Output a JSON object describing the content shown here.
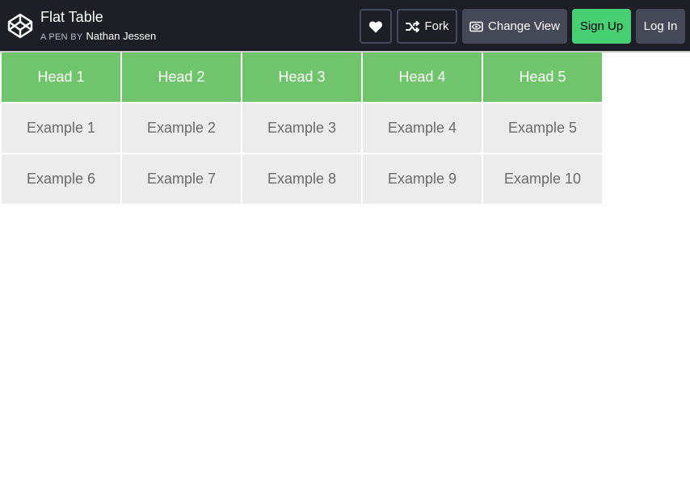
{
  "header": {
    "title": "Flat Table",
    "byline_prefix": "A PEN BY",
    "author": "Nathan Jessen",
    "logo_icon": "codepen-logo-icon",
    "buttons": {
      "heart_icon": "heart-icon",
      "fork_label": "Fork",
      "fork_icon": "fork-icon",
      "change_view_label": "Change View",
      "change_view_icon": "eye-box-icon",
      "signup_label": "Sign Up",
      "login_label": "Log In"
    }
  },
  "table": {
    "headers": [
      "Head 1",
      "Head 2",
      "Head 3",
      "Head 4",
      "Head 5"
    ],
    "rows": [
      [
        "Example 1",
        "Example 2",
        "Example 3",
        "Example 4",
        "Example 5"
      ],
      [
        "Example 6",
        "Example 7",
        "Example 8",
        "Example 9",
        "Example 10"
      ]
    ]
  },
  "colors": {
    "topbar_bg": "#1e1f26",
    "header_green": "#70c56c",
    "cell_gray": "#ececec",
    "signup_green": "#47cf73"
  }
}
